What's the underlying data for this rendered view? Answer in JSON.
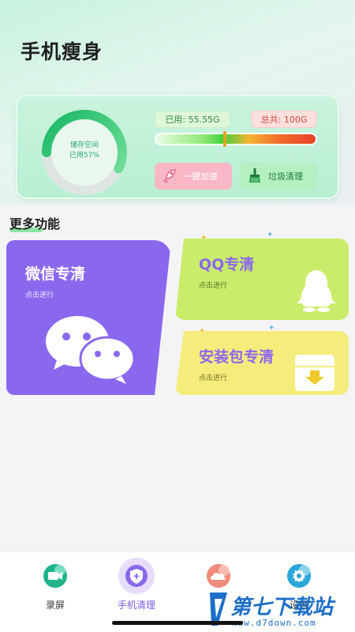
{
  "header": {
    "title": "手机瘦身"
  },
  "storage": {
    "ring_title": "储存空间",
    "ring_percent_text": "已用57%",
    "used_fraction": 0.57,
    "used_label": "已用: 55.55G",
    "total_label": "总共: 100G",
    "speed_button": "一键加速",
    "junk_button": "垃圾清理"
  },
  "section": {
    "title": "更多功能"
  },
  "features": {
    "wechat": {
      "title": "微信专清",
      "subtitle": "点击进行"
    },
    "qq": {
      "title": "QQ专清",
      "subtitle": "点击进行"
    },
    "apk": {
      "title": "安装包专清",
      "subtitle": "点击进行"
    }
  },
  "nav": {
    "items": [
      {
        "label": "录屏",
        "icon": "camera-icon"
      },
      {
        "label": "手机清理",
        "icon": "shield-icon"
      },
      {
        "label": "文",
        "icon": "cloud-icon"
      },
      {
        "label": "设置",
        "icon": "gear-icon"
      }
    ]
  },
  "watermark": {
    "brand": "第七下载站",
    "url": "www.d7down.com"
  },
  "colors": {
    "accent_purple": "#8a68ee",
    "accent_green": "#1fa96c",
    "qq_card": "#c9ec6a",
    "apk_card": "#f6ec7c"
  }
}
